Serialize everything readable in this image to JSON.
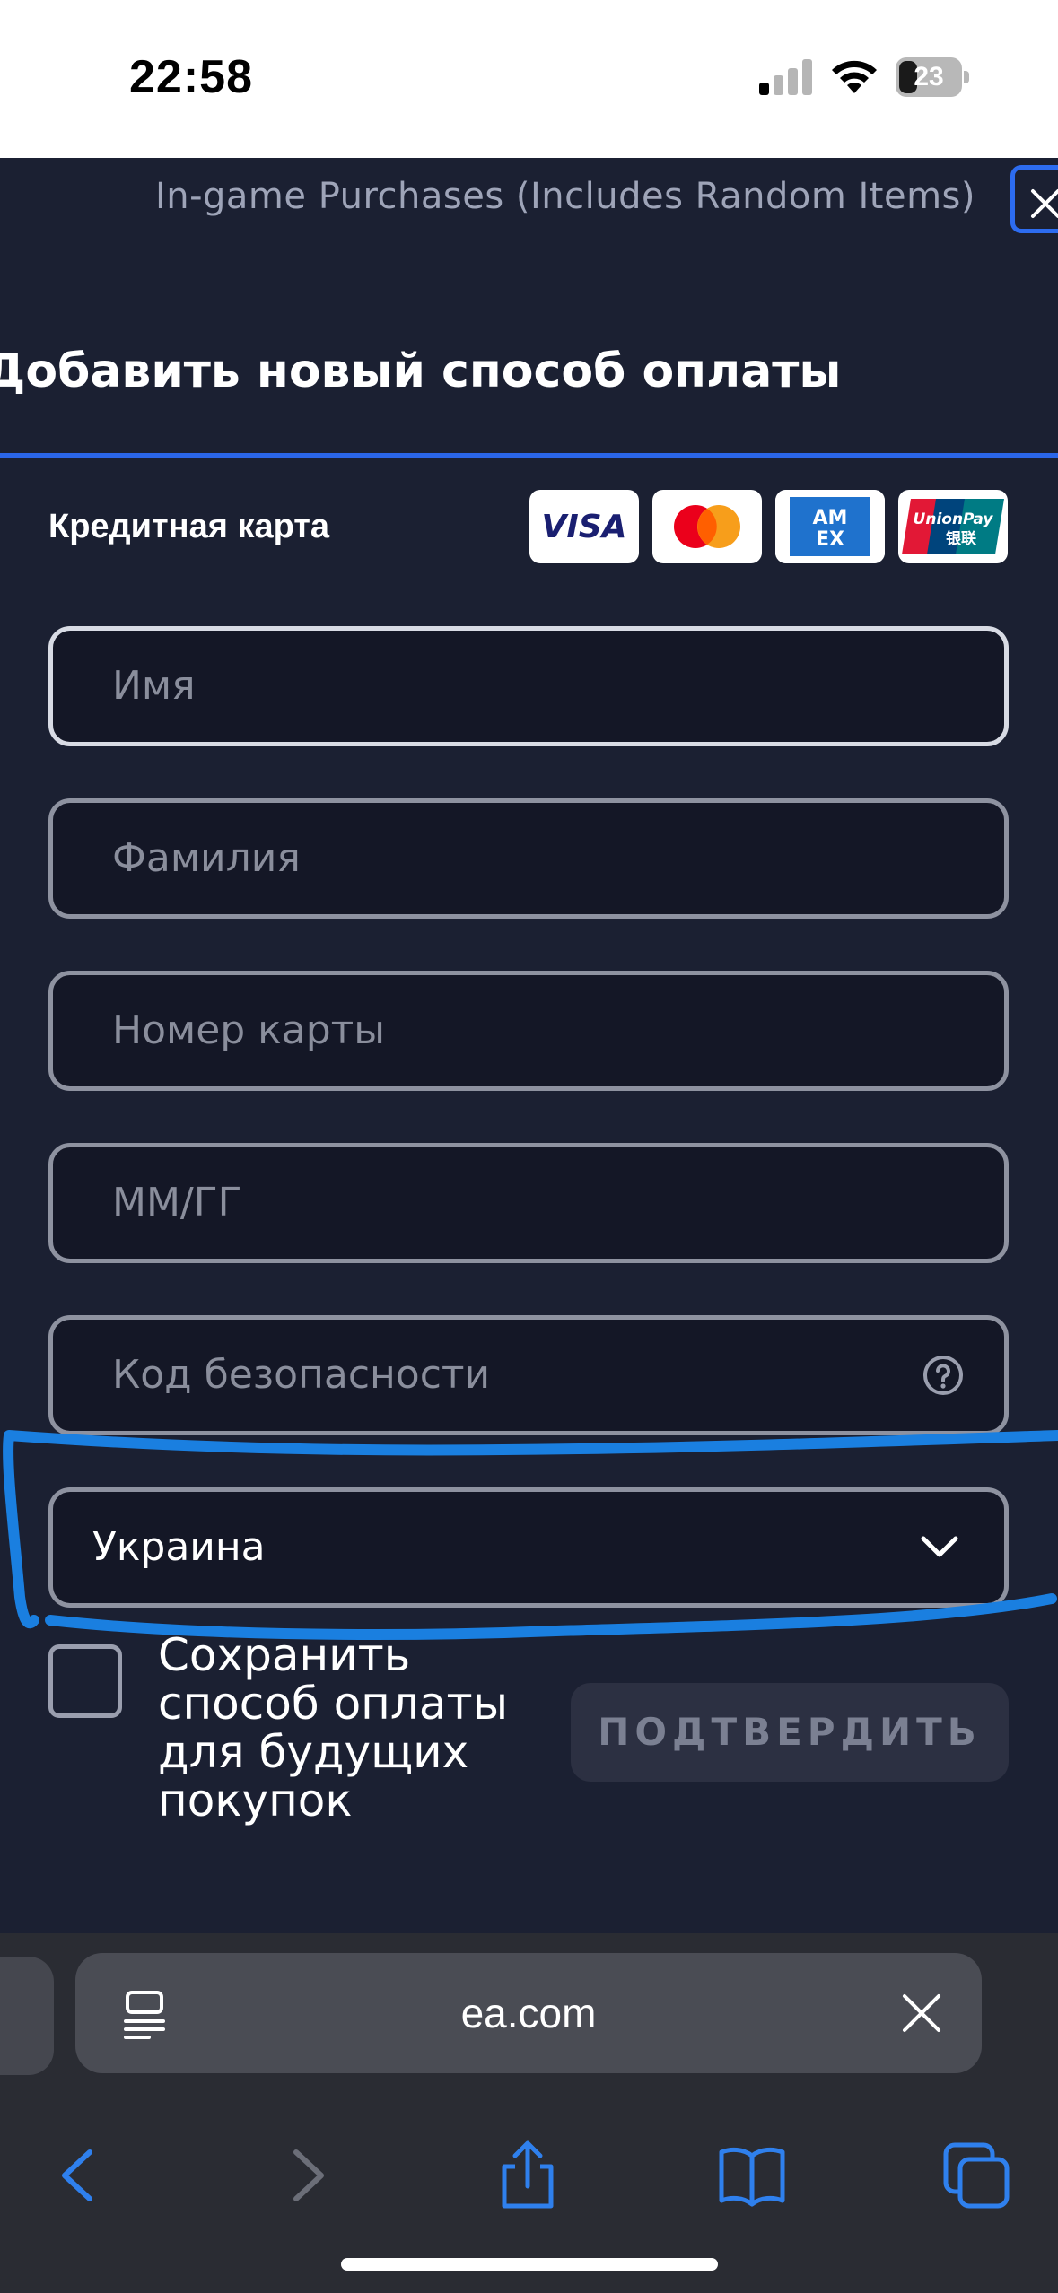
{
  "status_bar": {
    "time": "22:58",
    "battery": "23"
  },
  "header": {
    "rating_text": "In-game Purchases (Includes Random Items)",
    "title": "Добавить новый способ оплаты"
  },
  "form": {
    "card_type_label": "Кредитная карта",
    "card_logos": [
      {
        "name": "visa-logo",
        "text": "VISA"
      },
      {
        "name": "mastercard-logo",
        "text": ""
      },
      {
        "name": "amex-logo",
        "text": "AM EX"
      },
      {
        "name": "unionpay-logo",
        "text": "UnionPay 银联"
      }
    ],
    "first_name_placeholder": "Имя",
    "last_name_placeholder": "Фамилия",
    "card_number_placeholder": "Номер карты",
    "expiry_placeholder": "ММ/ГГ",
    "security_code_placeholder": "Код безопасности",
    "country_value": "Украина",
    "save_method_label": "Сохранить способ оплаты для будущих покупок",
    "save_method_checked": false,
    "confirm_label": "ПОДТВЕРДИТЬ"
  },
  "browser": {
    "url": "ea.com"
  },
  "colors": {
    "accent": "#2b66e8",
    "annotation_stroke": "#1a7fe0",
    "panel": "#1b2032",
    "field_bg": "#141726"
  }
}
